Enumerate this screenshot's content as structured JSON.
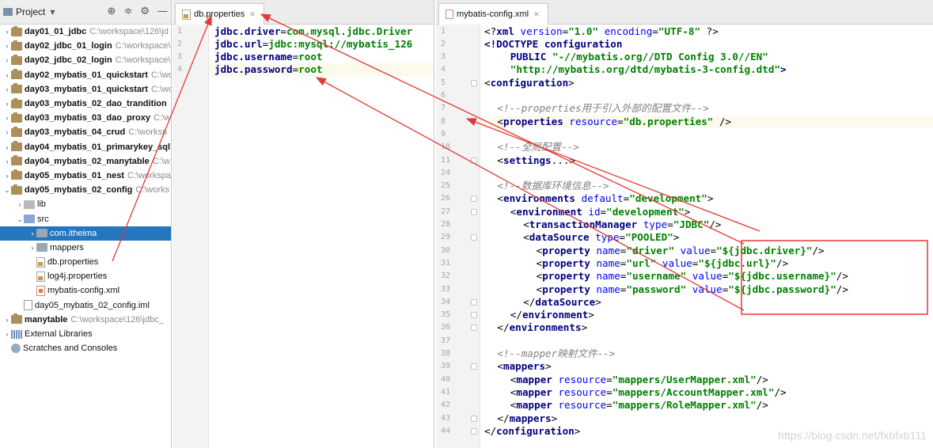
{
  "project_panel": {
    "title": "Project",
    "items": [
      {
        "arrow": "›",
        "icon": "module",
        "name": "day01_01_jdbc",
        "path": "C:\\workspace\\126\\jd",
        "bold": true
      },
      {
        "arrow": "›",
        "icon": "module",
        "name": "day02_jdbc_01_login",
        "path": "C:\\workspace\\",
        "bold": true
      },
      {
        "arrow": "›",
        "icon": "module",
        "name": "day02_jdbc_02_login",
        "path": "C:\\workspace\\",
        "bold": true
      },
      {
        "arrow": "›",
        "icon": "module",
        "name": "day02_mybatis_01_quickstart",
        "path": "C:\\wo",
        "bold": true
      },
      {
        "arrow": "›",
        "icon": "module",
        "name": "day03_mybatis_01_quickstart",
        "path": "C:\\wo",
        "bold": true
      },
      {
        "arrow": "›",
        "icon": "module",
        "name": "day03_mybatis_02_dao_trandition",
        "path": "",
        "bold": true
      },
      {
        "arrow": "›",
        "icon": "module",
        "name": "day03_mybatis_03_dao_proxy",
        "path": "C:\\w",
        "bold": true
      },
      {
        "arrow": "›",
        "icon": "module",
        "name": "day03_mybatis_04_crud",
        "path": "C:\\worksp",
        "bold": true
      },
      {
        "arrow": "›",
        "icon": "module",
        "name": "day04_mybatis_01_primarykey_sql",
        "path": "",
        "bold": true
      },
      {
        "arrow": "›",
        "icon": "module",
        "name": "day04_mybatis_02_manytable",
        "path": "C:\\w",
        "bold": true
      },
      {
        "arrow": "›",
        "icon": "module",
        "name": "day05_mybatis_01_nest",
        "path": "C:\\workspa",
        "bold": true
      },
      {
        "arrow": "⌄",
        "icon": "module",
        "name": "day05_mybatis_02_config",
        "path": "C:\\works",
        "bold": true
      },
      {
        "arrow": "›",
        "icon": "folder",
        "name": "lib",
        "path": "",
        "bold": false,
        "indent": 1
      },
      {
        "arrow": "⌄",
        "icon": "src",
        "name": "src",
        "path": "",
        "bold": false,
        "indent": 1
      },
      {
        "arrow": "›",
        "icon": "package",
        "name": "com.itheima",
        "path": "",
        "bold": false,
        "indent": 2,
        "selected": true
      },
      {
        "arrow": "›",
        "icon": "package",
        "name": "mappers",
        "path": "",
        "bold": false,
        "indent": 2
      },
      {
        "arrow": "",
        "icon": "properties",
        "name": "db.properties",
        "path": "",
        "bold": false,
        "indent": 2
      },
      {
        "arrow": "",
        "icon": "properties",
        "name": "log4j.properties",
        "path": "",
        "bold": false,
        "indent": 2
      },
      {
        "arrow": "",
        "icon": "xml",
        "name": "mybatis-config.xml",
        "path": "",
        "bold": false,
        "indent": 2
      },
      {
        "arrow": "",
        "icon": "iml",
        "name": "day05_mybatis_02_config.iml",
        "path": "",
        "bold": false,
        "indent": 1
      },
      {
        "arrow": "›",
        "icon": "module",
        "name": "manytable",
        "path": "C:\\workspace\\126\\jdbc_",
        "bold": true
      },
      {
        "arrow": "›",
        "icon": "libraries",
        "name": "External Libraries",
        "path": "",
        "bold": false
      },
      {
        "arrow": "",
        "icon": "scratches",
        "name": "Scratches and Consoles",
        "path": "",
        "bold": false
      }
    ]
  },
  "editor_left": {
    "tab_label": "db.properties",
    "lines": [
      {
        "n": "1",
        "parts": [
          [
            "k",
            "jdbc.driver"
          ],
          [
            "p",
            "="
          ],
          [
            "v",
            "com.mysql.jdbc.Driver"
          ]
        ]
      },
      {
        "n": "2",
        "parts": [
          [
            "k",
            "jdbc.url"
          ],
          [
            "p",
            "="
          ],
          [
            "v",
            "jdbc:mysql://mybatis_126"
          ]
        ]
      },
      {
        "n": "3",
        "parts": [
          [
            "k",
            "jdbc.username"
          ],
          [
            "p",
            "="
          ],
          [
            "v",
            "root"
          ]
        ]
      },
      {
        "n": "4",
        "parts": [
          [
            "k",
            "jdbc.password"
          ],
          [
            "p",
            "="
          ],
          [
            "v",
            "root"
          ]
        ]
      }
    ]
  },
  "editor_right": {
    "tab_label": "mybatis-config.xml",
    "lines": [
      {
        "n": "1",
        "ind": 0,
        "parts": [
          [
            "t",
            "<?"
          ],
          [
            "k",
            "xml"
          ],
          [
            "ak",
            " version"
          ],
          [
            "p",
            "="
          ],
          [
            "v",
            "\"1.0\""
          ],
          [
            "ak",
            " encoding"
          ],
          [
            "p",
            "="
          ],
          [
            "v",
            "\"UTF-8\""
          ],
          [
            "t",
            " ?>"
          ]
        ]
      },
      {
        "n": "2",
        "ind": 0,
        "parts": [
          [
            "k",
            "<!DOCTYPE"
          ],
          [
            "k",
            " configuration"
          ]
        ]
      },
      {
        "n": "3",
        "ind": 4,
        "parts": [
          [
            "k",
            "PUBLIC"
          ],
          [
            "v",
            " \"-//mybatis.org//DTD Config 3.0//EN\""
          ]
        ]
      },
      {
        "n": "4",
        "ind": 4,
        "parts": [
          [
            "v",
            "\"http://mybatis.org/dtd/mybatis-3-config.dtd\""
          ],
          [
            "k",
            ">"
          ]
        ]
      },
      {
        "n": "5",
        "ind": 0,
        "parts": [
          [
            "t",
            "<"
          ],
          [
            "k",
            "configuration"
          ],
          [
            "t",
            ">"
          ]
        ]
      },
      {
        "n": "6",
        "ind": 0,
        "parts": []
      },
      {
        "n": "7",
        "ind": 2,
        "parts": [
          [
            "c",
            "<!--properties用于引入外部的配置文件-->"
          ]
        ]
      },
      {
        "n": "8",
        "ind": 2,
        "parts": [
          [
            "t",
            "<"
          ],
          [
            "k",
            "properties"
          ],
          [
            "ak",
            " resource"
          ],
          [
            "p",
            "="
          ],
          [
            "v",
            "\"db.properties\""
          ],
          [
            "t",
            " />"
          ]
        ]
      },
      {
        "n": "9",
        "ind": 0,
        "parts": []
      },
      {
        "n": "10",
        "ind": 2,
        "parts": [
          [
            "c",
            "<!--全局配置-->"
          ]
        ]
      },
      {
        "n": "11",
        "ind": 2,
        "parts": [
          [
            "t",
            "<"
          ],
          [
            "k",
            "settings"
          ],
          [
            "t",
            "...>"
          ]
        ]
      },
      {
        "n": "24",
        "ind": 0,
        "parts": []
      },
      {
        "n": "25",
        "ind": 2,
        "parts": [
          [
            "c",
            "<!--数据库环境信息-->"
          ]
        ]
      },
      {
        "n": "26",
        "ind": 2,
        "parts": [
          [
            "t",
            "<"
          ],
          [
            "k",
            "environments"
          ],
          [
            "ak",
            " default"
          ],
          [
            "p",
            "="
          ],
          [
            "v",
            "\"development\""
          ],
          [
            "t",
            ">"
          ]
        ]
      },
      {
        "n": "27",
        "ind": 4,
        "parts": [
          [
            "t",
            "<"
          ],
          [
            "k",
            "environment"
          ],
          [
            "ak",
            " id"
          ],
          [
            "p",
            "="
          ],
          [
            "v",
            "\"development\""
          ],
          [
            "t",
            ">"
          ]
        ]
      },
      {
        "n": "28",
        "ind": 6,
        "parts": [
          [
            "t",
            "<"
          ],
          [
            "k",
            "transactionManager"
          ],
          [
            "ak",
            " type"
          ],
          [
            "p",
            "="
          ],
          [
            "v",
            "\"JDBC\""
          ],
          [
            "t",
            "/>"
          ]
        ]
      },
      {
        "n": "29",
        "ind": 6,
        "parts": [
          [
            "t",
            "<"
          ],
          [
            "k",
            "dataSource"
          ],
          [
            "ak",
            " type"
          ],
          [
            "p",
            "="
          ],
          [
            "v",
            "\"POOLED\""
          ],
          [
            "t",
            ">"
          ]
        ]
      },
      {
        "n": "30",
        "ind": 8,
        "parts": [
          [
            "t",
            "<"
          ],
          [
            "k",
            "property"
          ],
          [
            "ak",
            " name"
          ],
          [
            "p",
            "="
          ],
          [
            "v",
            "\"driver\""
          ],
          [
            "ak",
            " value"
          ],
          [
            "p",
            "="
          ],
          [
            "v",
            "\"${jdbc.driver}\""
          ],
          [
            "t",
            "/>"
          ]
        ]
      },
      {
        "n": "31",
        "ind": 8,
        "parts": [
          [
            "t",
            "<"
          ],
          [
            "k",
            "property"
          ],
          [
            "ak",
            " name"
          ],
          [
            "p",
            "="
          ],
          [
            "v",
            "\"url\""
          ],
          [
            "ak",
            " value"
          ],
          [
            "p",
            "="
          ],
          [
            "v",
            "\"${jdbc.url}\""
          ],
          [
            "t",
            "/>"
          ]
        ]
      },
      {
        "n": "32",
        "ind": 8,
        "parts": [
          [
            "t",
            "<"
          ],
          [
            "k",
            "property"
          ],
          [
            "ak",
            " name"
          ],
          [
            "p",
            "="
          ],
          [
            "v",
            "\"username\""
          ],
          [
            "ak",
            " value"
          ],
          [
            "p",
            "="
          ],
          [
            "v",
            "\"${jdbc.username}\""
          ],
          [
            "t",
            "/>"
          ]
        ]
      },
      {
        "n": "33",
        "ind": 8,
        "parts": [
          [
            "t",
            "<"
          ],
          [
            "k",
            "property"
          ],
          [
            "ak",
            " name"
          ],
          [
            "p",
            "="
          ],
          [
            "v",
            "\"password\""
          ],
          [
            "ak",
            " value"
          ],
          [
            "p",
            "="
          ],
          [
            "v",
            "\"${jdbc.password}\""
          ],
          [
            "t",
            "/>"
          ]
        ]
      },
      {
        "n": "34",
        "ind": 6,
        "parts": [
          [
            "t",
            "</"
          ],
          [
            "k",
            "dataSource"
          ],
          [
            "t",
            ">"
          ]
        ]
      },
      {
        "n": "35",
        "ind": 4,
        "parts": [
          [
            "t",
            "</"
          ],
          [
            "k",
            "environment"
          ],
          [
            "t",
            ">"
          ]
        ]
      },
      {
        "n": "36",
        "ind": 2,
        "parts": [
          [
            "t",
            "</"
          ],
          [
            "k",
            "environments"
          ],
          [
            "t",
            ">"
          ]
        ]
      },
      {
        "n": "37",
        "ind": 0,
        "parts": []
      },
      {
        "n": "38",
        "ind": 2,
        "parts": [
          [
            "c",
            "<!--mapper映射文件-->"
          ]
        ]
      },
      {
        "n": "39",
        "ind": 2,
        "parts": [
          [
            "t",
            "<"
          ],
          [
            "k",
            "mappers"
          ],
          [
            "t",
            ">"
          ]
        ]
      },
      {
        "n": "40",
        "ind": 4,
        "parts": [
          [
            "t",
            "<"
          ],
          [
            "k",
            "mapper"
          ],
          [
            "ak",
            " resource"
          ],
          [
            "p",
            "="
          ],
          [
            "v",
            "\"mappers/UserMapper.xml\""
          ],
          [
            "t",
            "/>"
          ]
        ]
      },
      {
        "n": "41",
        "ind": 4,
        "parts": [
          [
            "t",
            "<"
          ],
          [
            "k",
            "mapper"
          ],
          [
            "ak",
            " resource"
          ],
          [
            "p",
            "="
          ],
          [
            "v",
            "\"mappers/AccountMapper.xml\""
          ],
          [
            "t",
            "/>"
          ]
        ]
      },
      {
        "n": "42",
        "ind": 4,
        "parts": [
          [
            "t",
            "<"
          ],
          [
            "k",
            "mapper"
          ],
          [
            "ak",
            " resource"
          ],
          [
            "p",
            "="
          ],
          [
            "v",
            "\"mappers/RoleMapper.xml\""
          ],
          [
            "t",
            "/>"
          ]
        ]
      },
      {
        "n": "43",
        "ind": 2,
        "parts": [
          [
            "t",
            "</"
          ],
          [
            "k",
            "mappers"
          ],
          [
            "t",
            ">"
          ]
        ]
      },
      {
        "n": "44",
        "ind": 0,
        "parts": [
          [
            "t",
            "</"
          ],
          [
            "k",
            "configuration"
          ],
          [
            "t",
            ">"
          ]
        ]
      }
    ]
  },
  "colors": {
    "annotation": "#e53935",
    "selection": "#2675bf"
  },
  "watermark": "https://blog.csdn.net/fxbfxb111"
}
